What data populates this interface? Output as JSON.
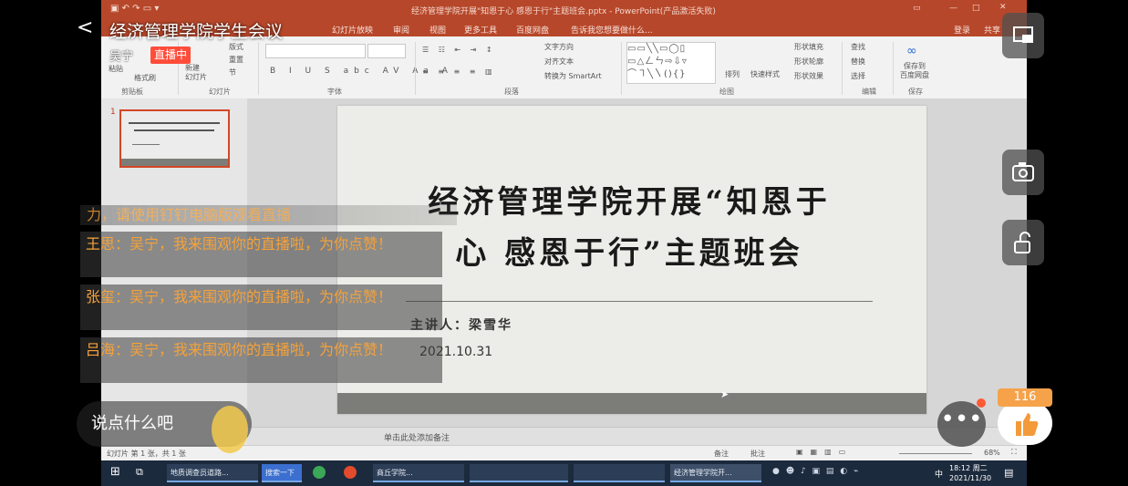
{
  "live": {
    "title": "经济管理学院学生会议",
    "host": "吴宁",
    "live_badge": "直播中",
    "chat_hint": "力，请使用钉钉电脑版观看直播",
    "messages": [
      {
        "text": "王思：吴宁，我来围观你的直播啦，为你点赞！"
      },
      {
        "text": "张玺：吴宁，我来围观你的直播啦，为你点赞！"
      },
      {
        "text": "吕海：吴宁，我来围观你的直播啦，为你点赞！"
      }
    ],
    "say_placeholder": "说点什么吧",
    "like_count": "116",
    "more_label": "•••"
  },
  "ppt": {
    "window_title": "经济管理学院开展\"知恩于心 感恩于行\"主题班会.pptx - PowerPoint(产品激活失败)",
    "tabs": [
      "幻灯片放映",
      "审阅",
      "视图",
      "更多工具",
      "百度网盘",
      "告诉我您想要做什么..."
    ],
    "login": "登录",
    "share": "共享",
    "ribbon": {
      "paste": "粘贴",
      "new_slide": "新建\n幻灯片",
      "layout": "版式",
      "reset": "重置",
      "section": "节",
      "format_painter": "格式刷",
      "groups": [
        "剪贴板",
        "幻灯片",
        "字体",
        "段落",
        "绘图",
        "编辑",
        "保存"
      ],
      "text_direction": "文字方向",
      "align_text": "对齐文本",
      "smartart": "转换为 SmartArt",
      "arrange": "排列",
      "quick_styles": "快速样式",
      "shape_fill": "形状填充",
      "shape_outline": "形状轮廓",
      "shape_effects": "形状效果",
      "find": "查找",
      "replace": "替换",
      "select": "选择",
      "save_baidu": "保存到\n百度网盘"
    },
    "thumb": {
      "number": "1"
    },
    "slide": {
      "title_line1": "经济管理学院开展“知恩于",
      "title_line2": "心   感恩于行”主题班会",
      "presenter": "主讲人：梁雪华",
      "date": "2021.10.31"
    },
    "notes": "单击此处添加备注",
    "status": {
      "slide_info": "幻灯片 第 1 张，共 1 张",
      "notes_btn": "备注",
      "comments_btn": "批注",
      "zoom": "68%"
    },
    "taskbar": {
      "items": [
        "地质调查员道路...",
        "搜索一下",
        "商丘学院...",
        "经济管理学院开..."
      ],
      "time": "18:12 周二",
      "date": "2021/11/30",
      "ime": "中"
    }
  },
  "colors": {
    "ppt_accent": "#b7472a",
    "live_badge": "#ff4d3a",
    "chat_text": "#f5a23a",
    "like_badge": "#f5a24a"
  }
}
